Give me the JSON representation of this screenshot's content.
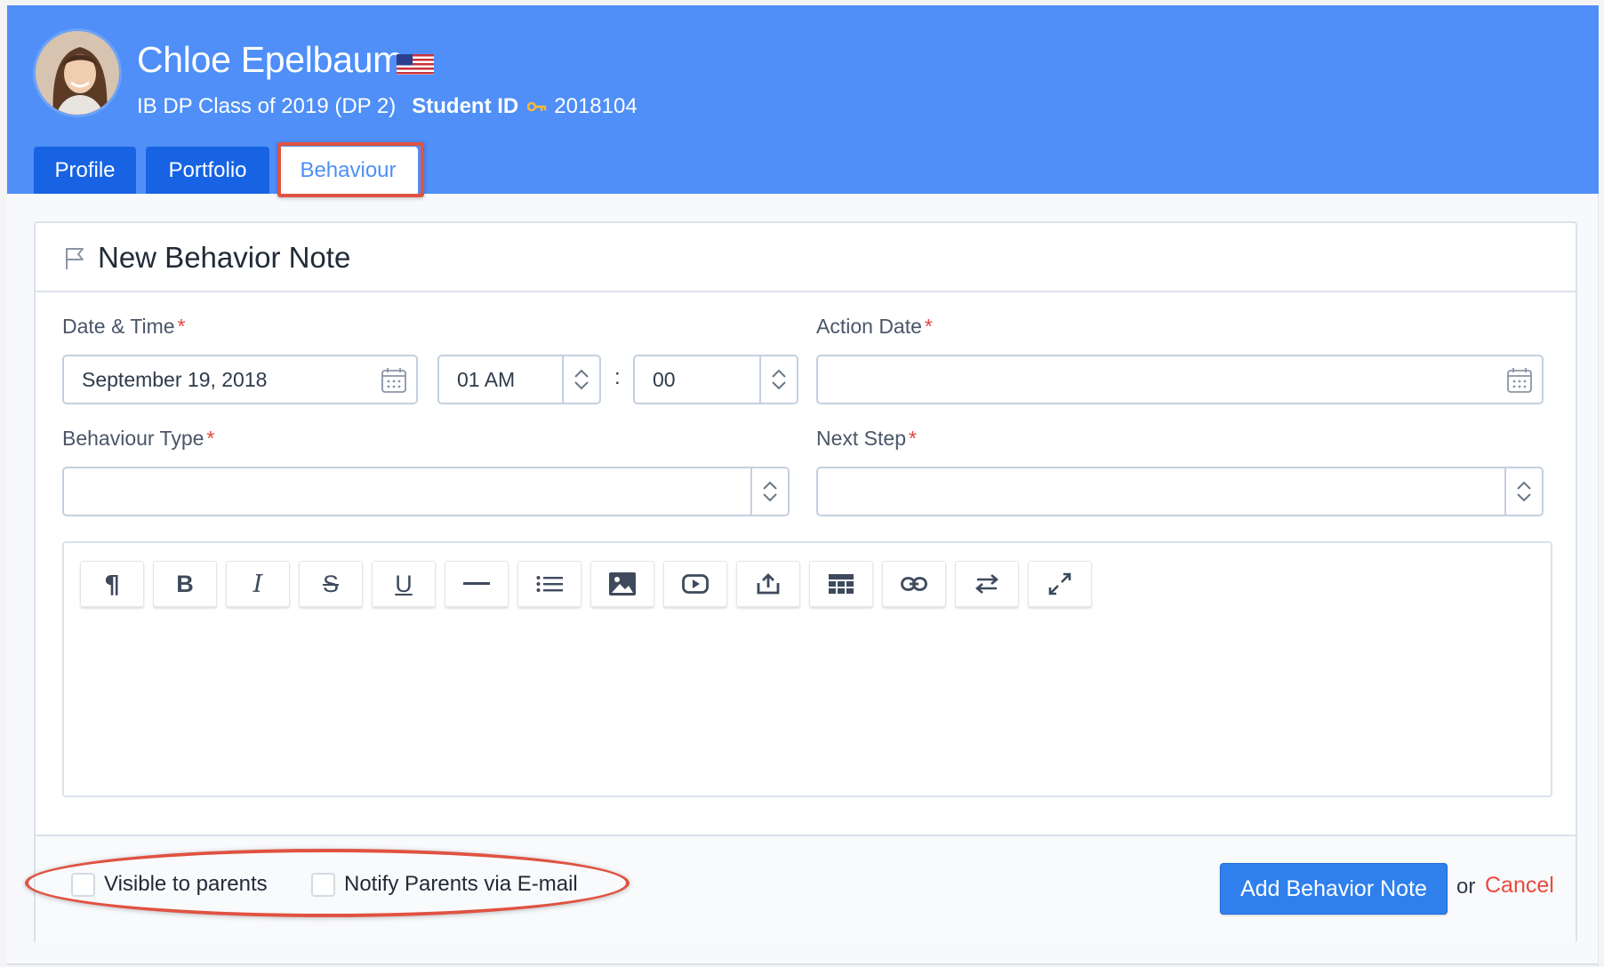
{
  "student": {
    "name": "Chloe Epelbaum",
    "class": "IB DP Class of 2019 (DP 2)",
    "id_label": "Student ID",
    "id_value": "2018104"
  },
  "tabs": [
    {
      "label": "Profile",
      "active": false
    },
    {
      "label": "Portfolio",
      "active": false
    },
    {
      "label": "Behaviour",
      "active": true
    }
  ],
  "form": {
    "title": "New Behavior Note",
    "date_time": {
      "label": "Date & Time",
      "required_mark": "*",
      "date_value": "September 19, 2018",
      "hour_value": "01 AM",
      "separator": ":",
      "minute_value": "00"
    },
    "action_date": {
      "label": "Action Date",
      "required_mark": "*",
      "value": ""
    },
    "behaviour_type": {
      "label": "Behaviour Type",
      "required_mark": "*",
      "value": ""
    },
    "next_step": {
      "label": "Next Step",
      "required_mark": "*",
      "value": ""
    },
    "editor_toolbar": [
      "paragraph-icon",
      "bold-icon",
      "italic-icon",
      "strikethrough-icon",
      "underline-icon",
      "horizontal-rule-icon",
      "list-icon",
      "image-icon",
      "video-icon",
      "upload-icon",
      "table-icon",
      "link-icon",
      "align-icon",
      "fullscreen-icon"
    ],
    "editor_glyphs": {
      "paragraph": "¶",
      "bold": "B",
      "italic": "I",
      "strikethrough": "S",
      "underline": "U"
    },
    "visible_to_parents_label": "Visible to parents",
    "notify_parents_label": "Notify Parents via E-mail",
    "submit_label": "Add Behavior Note",
    "or_text": "or",
    "cancel_label": "Cancel"
  },
  "colors": {
    "header_bg": "#4f8ff7",
    "tab_bg": "#1763e3",
    "primary_button": "#2f80ed",
    "cancel": "#e84a3c",
    "annotation": "#e05242"
  }
}
